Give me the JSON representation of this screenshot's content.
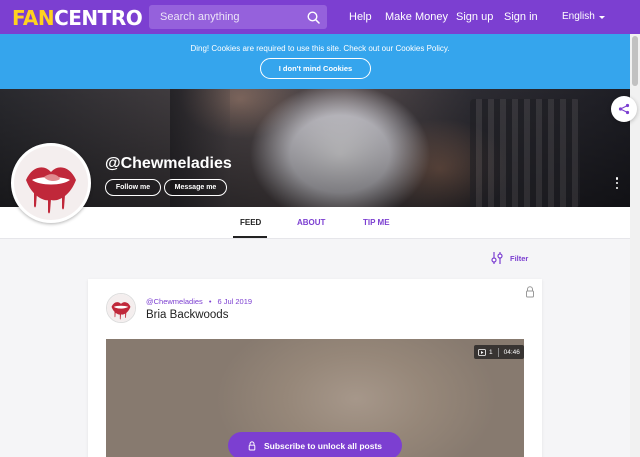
{
  "header": {
    "logo_part1": "FAN",
    "logo_part2": "CENTRO",
    "search_placeholder": "Search anything",
    "nav": [
      "Help",
      "Make Money",
      "Sign up",
      "Sign in"
    ],
    "language": "English",
    "brand_color": "#7c3fd1",
    "logo_accent": "#ffd21f"
  },
  "cookie_banner": {
    "text": "Ding! Cookies are required to use this site. Check out our Cookies Policy.",
    "button": "I don't mind Cookies",
    "color": "#35a5ed"
  },
  "profile": {
    "username": "@Chewmeladies",
    "follow_label": "Follow me",
    "message_label": "Message me"
  },
  "tabs": {
    "items": [
      "FEED",
      "ABOUT",
      "TIP ME"
    ],
    "active": "FEED"
  },
  "feed": {
    "filter_label": "Filter"
  },
  "post": {
    "author": "@Chewmeladies",
    "date": "6 Jul 2019",
    "title": "Bria Backwoods",
    "media_count": "1",
    "duration": "04:46",
    "subscribe_label": "Subscribe to unlock all posts"
  },
  "icons": {
    "search": "search-icon",
    "share": "share-icon",
    "more": "more-vertical-icon",
    "filter": "filter-icon",
    "lock": "lock-icon",
    "video": "video-icon"
  }
}
